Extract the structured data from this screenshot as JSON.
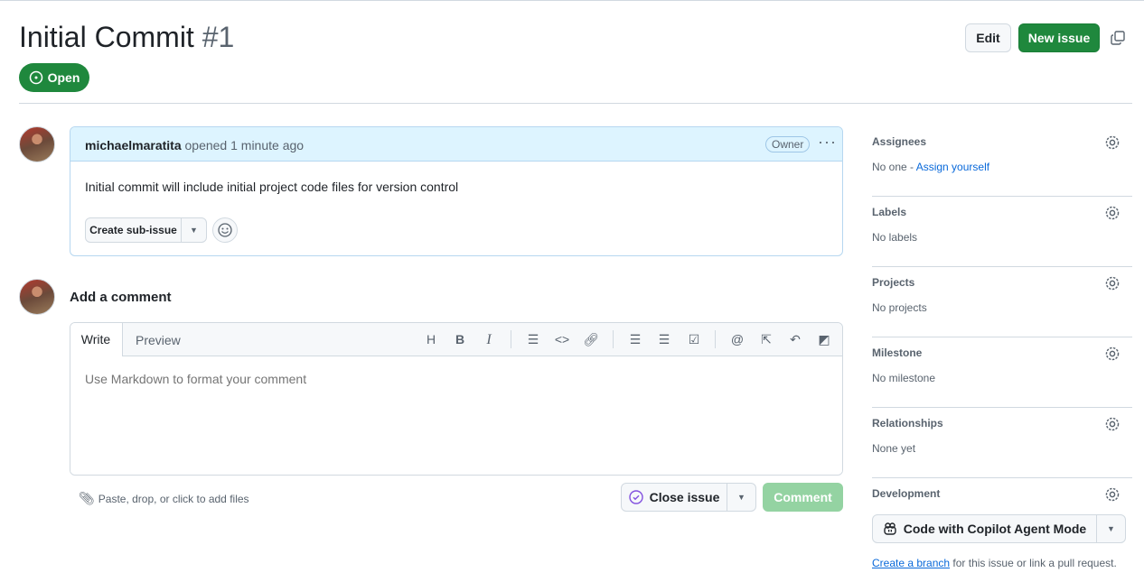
{
  "header": {
    "title": "Initial Commit",
    "number": "#1",
    "status": "Open",
    "edit_label": "Edit",
    "new_issue_label": "New issue"
  },
  "comment": {
    "author": "michaelmaratita",
    "action": "opened 1 minute ago",
    "role": "Owner",
    "body": "Initial commit will include initial project code files for version control",
    "sub_issue_label": "Create sub-issue"
  },
  "composer": {
    "heading": "Add a comment",
    "tabs": [
      "Write",
      "Preview"
    ],
    "placeholder": "Use Markdown to format your comment",
    "attach_label": "Paste, drop, or click to add files",
    "close_label": "Close issue",
    "comment_label": "Comment"
  },
  "sidebar": {
    "sections": [
      {
        "title": "Assignees",
        "value": "No one - ",
        "link": "Assign yourself"
      },
      {
        "title": "Labels",
        "value": "No labels"
      },
      {
        "title": "Projects",
        "value": "No projects"
      },
      {
        "title": "Milestone",
        "value": "No milestone"
      },
      {
        "title": "Relationships",
        "value": "None yet"
      },
      {
        "title": "Development"
      }
    ],
    "copilot_label": "Code with Copilot Agent Mode",
    "branch_link": "Create a branch",
    "branch_text": " for this issue or link a pull request."
  },
  "colors": {
    "green": "#1f883d",
    "accent": "#0969da",
    "done": "#8250df"
  }
}
